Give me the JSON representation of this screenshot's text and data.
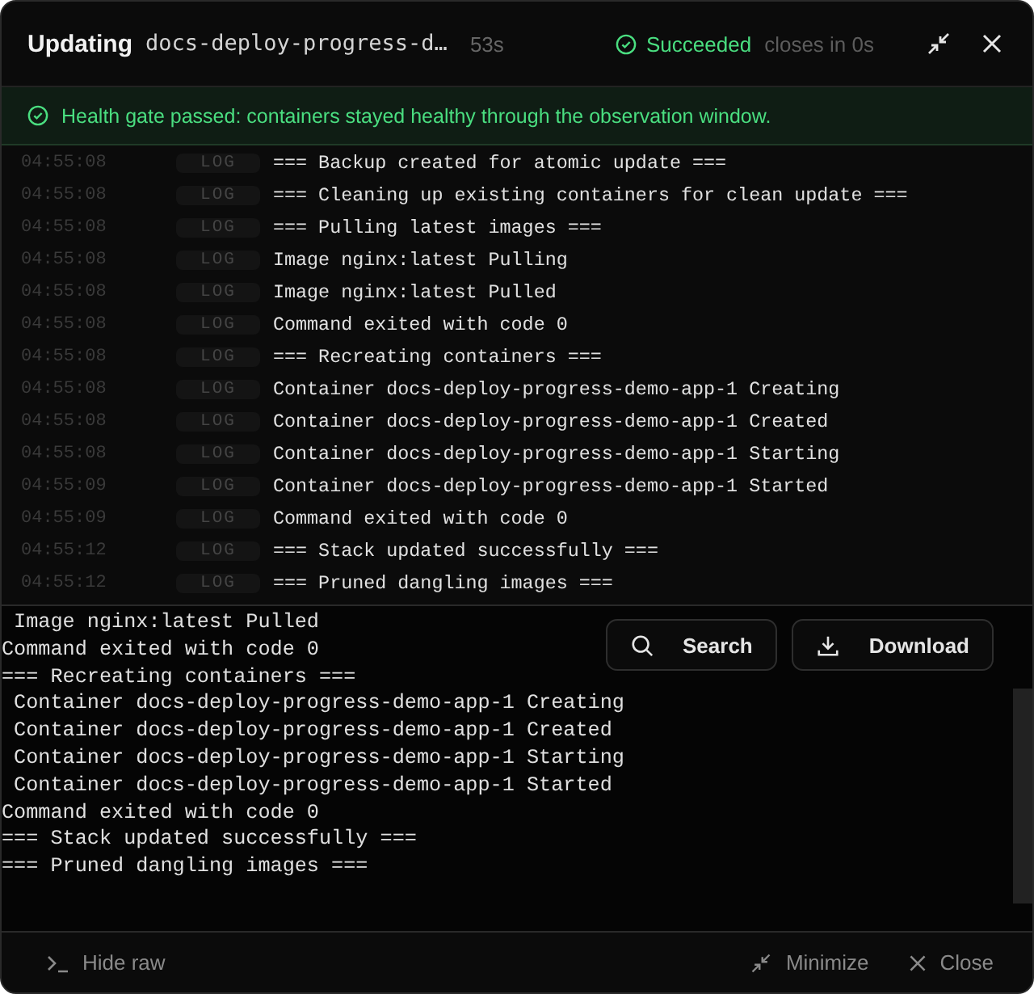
{
  "header": {
    "action": "Updating",
    "target": "docs-deploy-progress-d…",
    "elapsed": "53s",
    "status": "Succeeded",
    "countdown": "closes in 0s"
  },
  "banner": {
    "text": "Health gate passed: containers stayed healthy through the observation window."
  },
  "log": [
    {
      "time": "04:55:08",
      "level": "LOG",
      "message": "=== Backup created for atomic update ==="
    },
    {
      "time": "04:55:08",
      "level": "LOG",
      "message": "=== Cleaning up existing containers for clean update ==="
    },
    {
      "time": "04:55:08",
      "level": "LOG",
      "message": "=== Pulling latest images ==="
    },
    {
      "time": "04:55:08",
      "level": "LOG",
      "message": "Image nginx:latest Pulling"
    },
    {
      "time": "04:55:08",
      "level": "LOG",
      "message": "Image nginx:latest Pulled"
    },
    {
      "time": "04:55:08",
      "level": "LOG",
      "message": "Command exited with code 0"
    },
    {
      "time": "04:55:08",
      "level": "LOG",
      "message": "=== Recreating containers ==="
    },
    {
      "time": "04:55:08",
      "level": "LOG",
      "message": "Container docs-deploy-progress-demo-app-1 Creating"
    },
    {
      "time": "04:55:08",
      "level": "LOG",
      "message": "Container docs-deploy-progress-demo-app-1 Created"
    },
    {
      "time": "04:55:08",
      "level": "LOG",
      "message": "Container docs-deploy-progress-demo-app-1 Starting"
    },
    {
      "time": "04:55:09",
      "level": "LOG",
      "message": "Container docs-deploy-progress-demo-app-1 Started"
    },
    {
      "time": "04:55:09",
      "level": "LOG",
      "message": "Command exited with code 0"
    },
    {
      "time": "04:55:12",
      "level": "LOG",
      "message": "=== Stack updated successfully ==="
    },
    {
      "time": "04:55:12",
      "level": "LOG",
      "message": "=== Pruned dangling images ==="
    }
  ],
  "raw_output": [
    " Image nginx:latest Pulled",
    "Command exited with code 0",
    "=== Recreating containers ===",
    " Container docs-deploy-progress-demo-app-1 Creating",
    " Container docs-deploy-progress-demo-app-1 Created",
    " Container docs-deploy-progress-demo-app-1 Starting",
    " Container docs-deploy-progress-demo-app-1 Started",
    "Command exited with code 0",
    "=== Stack updated successfully ===",
    "=== Pruned dangling images ==="
  ],
  "raw_buttons": [
    "Search",
    "Download"
  ],
  "footer": {
    "toggle": "Hide raw",
    "minimize": "Minimize",
    "close": "Close"
  }
}
